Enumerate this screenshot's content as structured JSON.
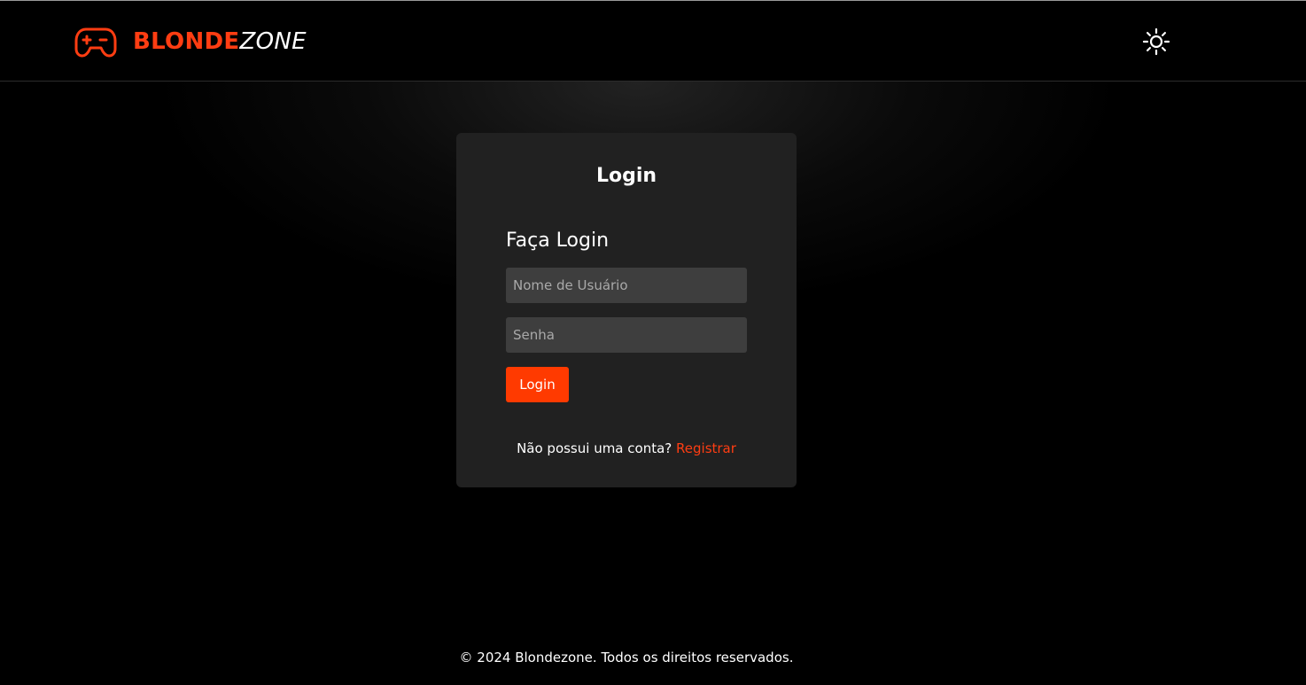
{
  "header": {
    "brand_part1": "BLONDE",
    "brand_part2": "ZONE",
    "logo_icon": "gamepad-icon",
    "theme_icon": "sun-icon"
  },
  "login_card": {
    "title": "Login",
    "form_heading": "Faça Login",
    "username_placeholder": "Nome de Usuário",
    "password_placeholder": "Senha",
    "username_value": "",
    "password_value": "",
    "submit_label": "Login",
    "register_prompt": "Não possui uma conta?",
    "register_link": "Registrar"
  },
  "footer": {
    "text": "© 2024 Blondezone. Todos os direitos reservados."
  },
  "colors": {
    "accent": "#ff3d12",
    "button": "#ff3a00",
    "card_bg": "#212121",
    "input_bg": "#3e3e3e",
    "page_bg": "#000000"
  }
}
